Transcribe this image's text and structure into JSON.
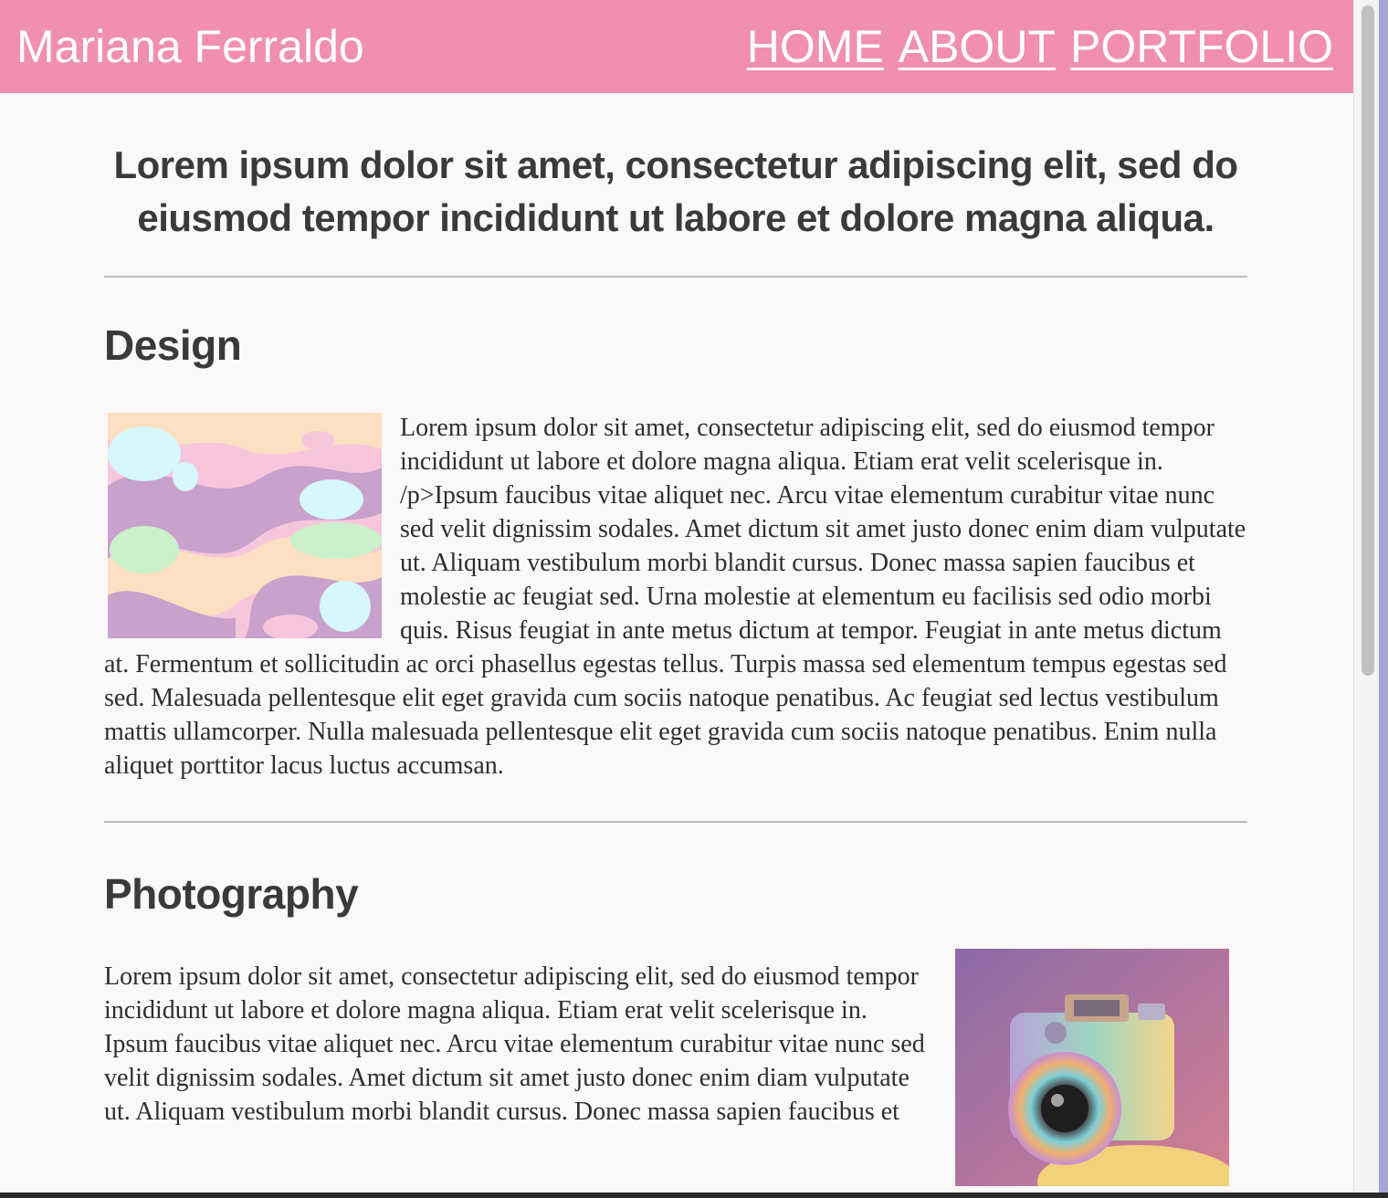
{
  "header": {
    "site_name": "Mariana Ferraldo",
    "nav": [
      {
        "label": "HOME"
      },
      {
        "label": "ABOUT"
      },
      {
        "label": "PORTFOLIO"
      }
    ],
    "background_color": "#f08fae"
  },
  "main": {
    "hero_heading": "Lorem ipsum dolor sit amet, consectetur adipiscing elit, sed do eiusmod tempor incididunt ut labore et dolore magna aliqua.",
    "sections": [
      {
        "title": "Design",
        "text": "Lorem ipsum dolor sit amet, consectetur adipiscing elit, sed do eiusmod tempor incididunt ut labore et dolore magna aliqua. Etiam erat velit scelerisque in. /p>Ipsum faucibus vitae aliquet nec. Arcu vitae elementum curabitur vitae nunc sed velit dignissim sodales. Amet dictum sit amet justo donec enim diam vulputate ut. Aliquam vestibulum morbi blandit cursus. Donec massa sapien faucibus et molestie ac feugiat sed. Urna molestie at elementum eu facilisis sed odio morbi quis. Risus feugiat in ante metus dictum at tempor. Feugiat in ante metus dictum at. Fermentum et sollicitudin ac orci phasellus egestas tellus. Turpis massa sed elementum tempus egestas sed sed. Malesuada pellentesque elit eget gravida cum sociis natoque penatibus. Ac feugiat sed lectus vestibulum mattis ullamcorper. Nulla malesuada pellentesque elit eget gravida cum sociis natoque penatibus. Enim nulla aliquet porttitor lacus luctus accumsan.",
        "image": "pastel-abstract-waves-image"
      },
      {
        "title": "Photography",
        "text": "Lorem ipsum dolor sit amet, consectetur adipiscing elit, sed do eiusmod tempor incididunt ut labore et dolore magna aliqua. Etiam erat velit scelerisque in. Ipsum faucibus vitae aliquet nec. Arcu vitae elementum curabitur vitae nunc sed velit dignissim sodales. Amet dictum sit amet justo donec enim diam vulputate ut. Aliquam vestibulum morbi blandit cursus. Donec massa sapien faucibus et",
        "image": "pastel-camera-image"
      }
    ]
  }
}
